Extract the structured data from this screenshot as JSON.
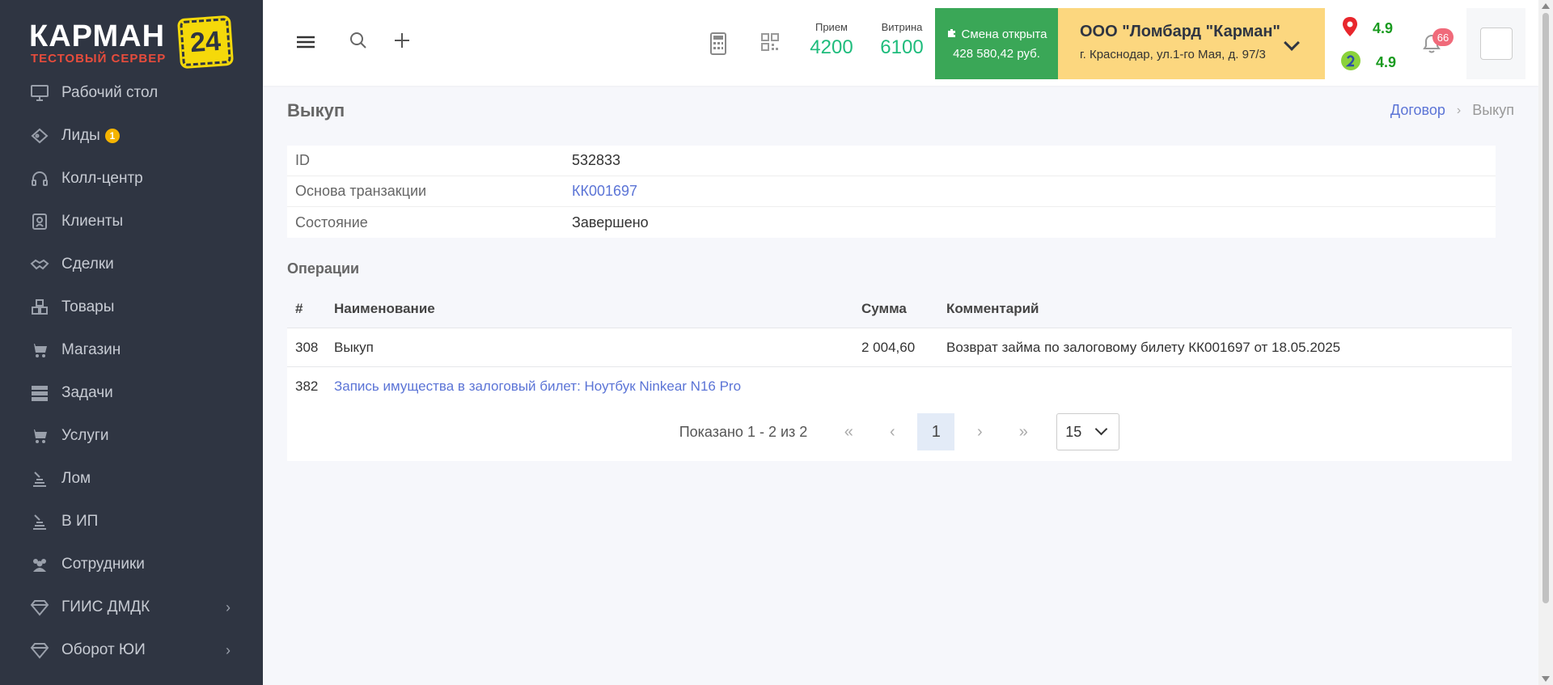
{
  "logo": {
    "brand": "КАРМАН",
    "number": "24",
    "subtitle": "ТЕСТОВЫЙ СЕРВЕР"
  },
  "sidebar": {
    "items": [
      {
        "label": "Рабочий стол",
        "icon": "monitor-icon"
      },
      {
        "label": "Лиды",
        "icon": "tag-icon",
        "count": "1"
      },
      {
        "label": "Колл-центр",
        "icon": "headset-icon"
      },
      {
        "label": "Клиенты",
        "icon": "contact-card-icon"
      },
      {
        "label": "Сделки",
        "icon": "handshake-icon"
      },
      {
        "label": "Товары",
        "icon": "boxes-icon"
      },
      {
        "label": "Магазин",
        "icon": "cart-icon"
      },
      {
        "label": "Задачи",
        "icon": "server-icon"
      },
      {
        "label": "Услуги",
        "icon": "cart-icon"
      },
      {
        "label": "Лом",
        "icon": "stack-icon"
      },
      {
        "label": "В ИП",
        "icon": "stack-icon"
      },
      {
        "label": "Сотрудники",
        "icon": "users-icon"
      },
      {
        "label": "ГИИС ДМДК",
        "icon": "diamond-icon",
        "expandable": true
      },
      {
        "label": "Оборот ЮИ",
        "icon": "diamond-icon",
        "expandable": true
      }
    ]
  },
  "header": {
    "priem_label": "Прием",
    "priem_value": "4200",
    "vitrina_label": "Витрина",
    "vitrina_value": "6100",
    "shift_status": "Смена открыта",
    "shift_amount": "428 580,42 руб.",
    "org_name": "ООО \"Ломбард \"Карман\"",
    "org_address": "г. Краснодар, ул.1-го Мая, д. 97/3",
    "rating1": "4.9",
    "rating2": "4.9",
    "notifications": "66"
  },
  "page": {
    "title": "Выкуп",
    "breadcrumb_link": "Договор",
    "breadcrumb_current": "Выкуп"
  },
  "info": {
    "id_label": "ID",
    "id_value": "532833",
    "basis_label": "Основа транзакции",
    "basis_value": "КК001697",
    "state_label": "Состояние",
    "state_value": "Завершено"
  },
  "operations": {
    "title": "Операции",
    "columns": [
      "#",
      "Наименование",
      "Сумма",
      "Комментарий"
    ],
    "rows": [
      {
        "num": "308",
        "name": "Выкуп",
        "sum": "2 004,60",
        "comment": "Возврат займа по залоговому билету КК001697 от 18.05.2025"
      },
      {
        "num": "382",
        "name": "Запись имущества в залоговый билет: Ноутбук Ninkear N16 Pro",
        "sum": "",
        "comment": ""
      }
    ]
  },
  "pagination": {
    "shown": "Показано 1 - 2 из 2",
    "current_page": "1",
    "per_page": "15"
  },
  "colors": {
    "sidebar_bg": "#2f3542",
    "accent_green": "#1ebc7c",
    "shift_green": "#3aa757",
    "org_yellow": "#fcd77f",
    "link_blue": "#5b74d6",
    "badge_pink": "#f06a7a"
  }
}
